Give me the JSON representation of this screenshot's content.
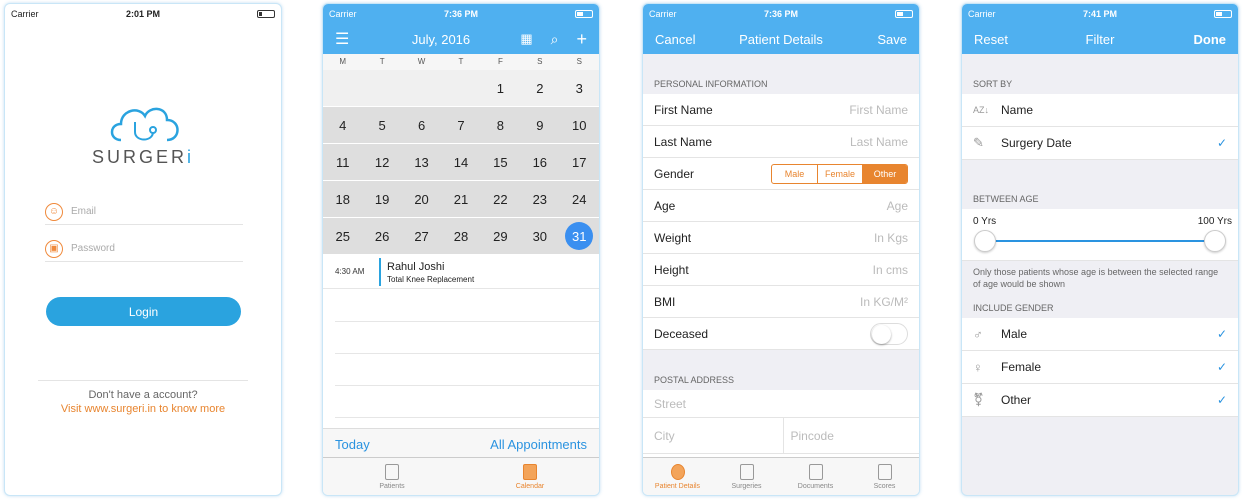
{
  "status": {
    "carrier": "Carrier",
    "wifi_icon": "wifi-icon"
  },
  "login": {
    "time": "2:01 PM",
    "brand_main": "SURGER",
    "brand_accent": "i",
    "email_placeholder": "Email",
    "password_placeholder": "Password",
    "login_label": "Login",
    "no_account": "Don't have a account?",
    "visit": "Visit www.surgeri.in to know more"
  },
  "calendar": {
    "time": "7:36 PM",
    "month": "July, 2016",
    "weekdays": [
      "M",
      "T",
      "W",
      "T",
      "F",
      "S",
      "S"
    ],
    "weeks": [
      [
        "",
        "",
        "",
        "",
        "1",
        "2",
        "3"
      ],
      [
        "4",
        "5",
        "6",
        "7",
        "8",
        "9",
        "10"
      ],
      [
        "11",
        "12",
        "13",
        "14",
        "15",
        "16",
        "17"
      ],
      [
        "18",
        "19",
        "20",
        "21",
        "22",
        "23",
        "24"
      ],
      [
        "25",
        "26",
        "27",
        "28",
        "29",
        "30",
        "31"
      ]
    ],
    "selected_day": "31",
    "appointment": {
      "time": "4:30 AM",
      "name": "Rahul  Joshi",
      "procedure": "Total Knee Replacement"
    },
    "today": "Today",
    "all": "All Appointments",
    "tabs": [
      {
        "label": "Patients"
      },
      {
        "label": "Calendar"
      }
    ]
  },
  "patient": {
    "time": "7:36 PM",
    "cancel": "Cancel",
    "title": "Patient Details",
    "save": "Save",
    "personal_header": "PERSONAL INFORMATION",
    "first_name": "First Name",
    "first_name_ph": "First Name",
    "last_name": "Last Name",
    "last_name_ph": "Last Name",
    "gender": "Gender",
    "gender_options": [
      "Male",
      "Female",
      "Other"
    ],
    "gender_selected": "Other",
    "age": "Age",
    "age_ph": "Age",
    "weight": "Weight",
    "weight_ph": "In Kgs",
    "height": "Height",
    "height_ph": "In cms",
    "bmi": "BMI",
    "bmi_ph": "In KG/M²",
    "deceased": "Deceased",
    "postal_header": "POSTAL ADDRESS",
    "street_ph": "Street",
    "city_ph": "City",
    "pincode_ph": "Pincode",
    "tabs": [
      {
        "label": "Patient Details"
      },
      {
        "label": "Surgeries"
      },
      {
        "label": "Documents"
      },
      {
        "label": "Scores"
      }
    ]
  },
  "filter": {
    "time": "7:41 PM",
    "reset": "Reset",
    "title": "Filter",
    "done": "Done",
    "sort_header": "SORT BY",
    "sort_name": "Name",
    "sort_date": "Surgery Date",
    "age_header": "BETWEEN AGE",
    "age_min": "0 Yrs",
    "age_max": "100 Yrs",
    "age_note": "Only those patients whose age is between the selected range of age would be shown",
    "gender_header": "INCLUDE GENDER",
    "male": "Male",
    "female": "Female",
    "other": "Other",
    "check": "✓"
  },
  "colors": {
    "accent_blue": "#4fb0f0",
    "accent_orange": "#e8852f"
  }
}
